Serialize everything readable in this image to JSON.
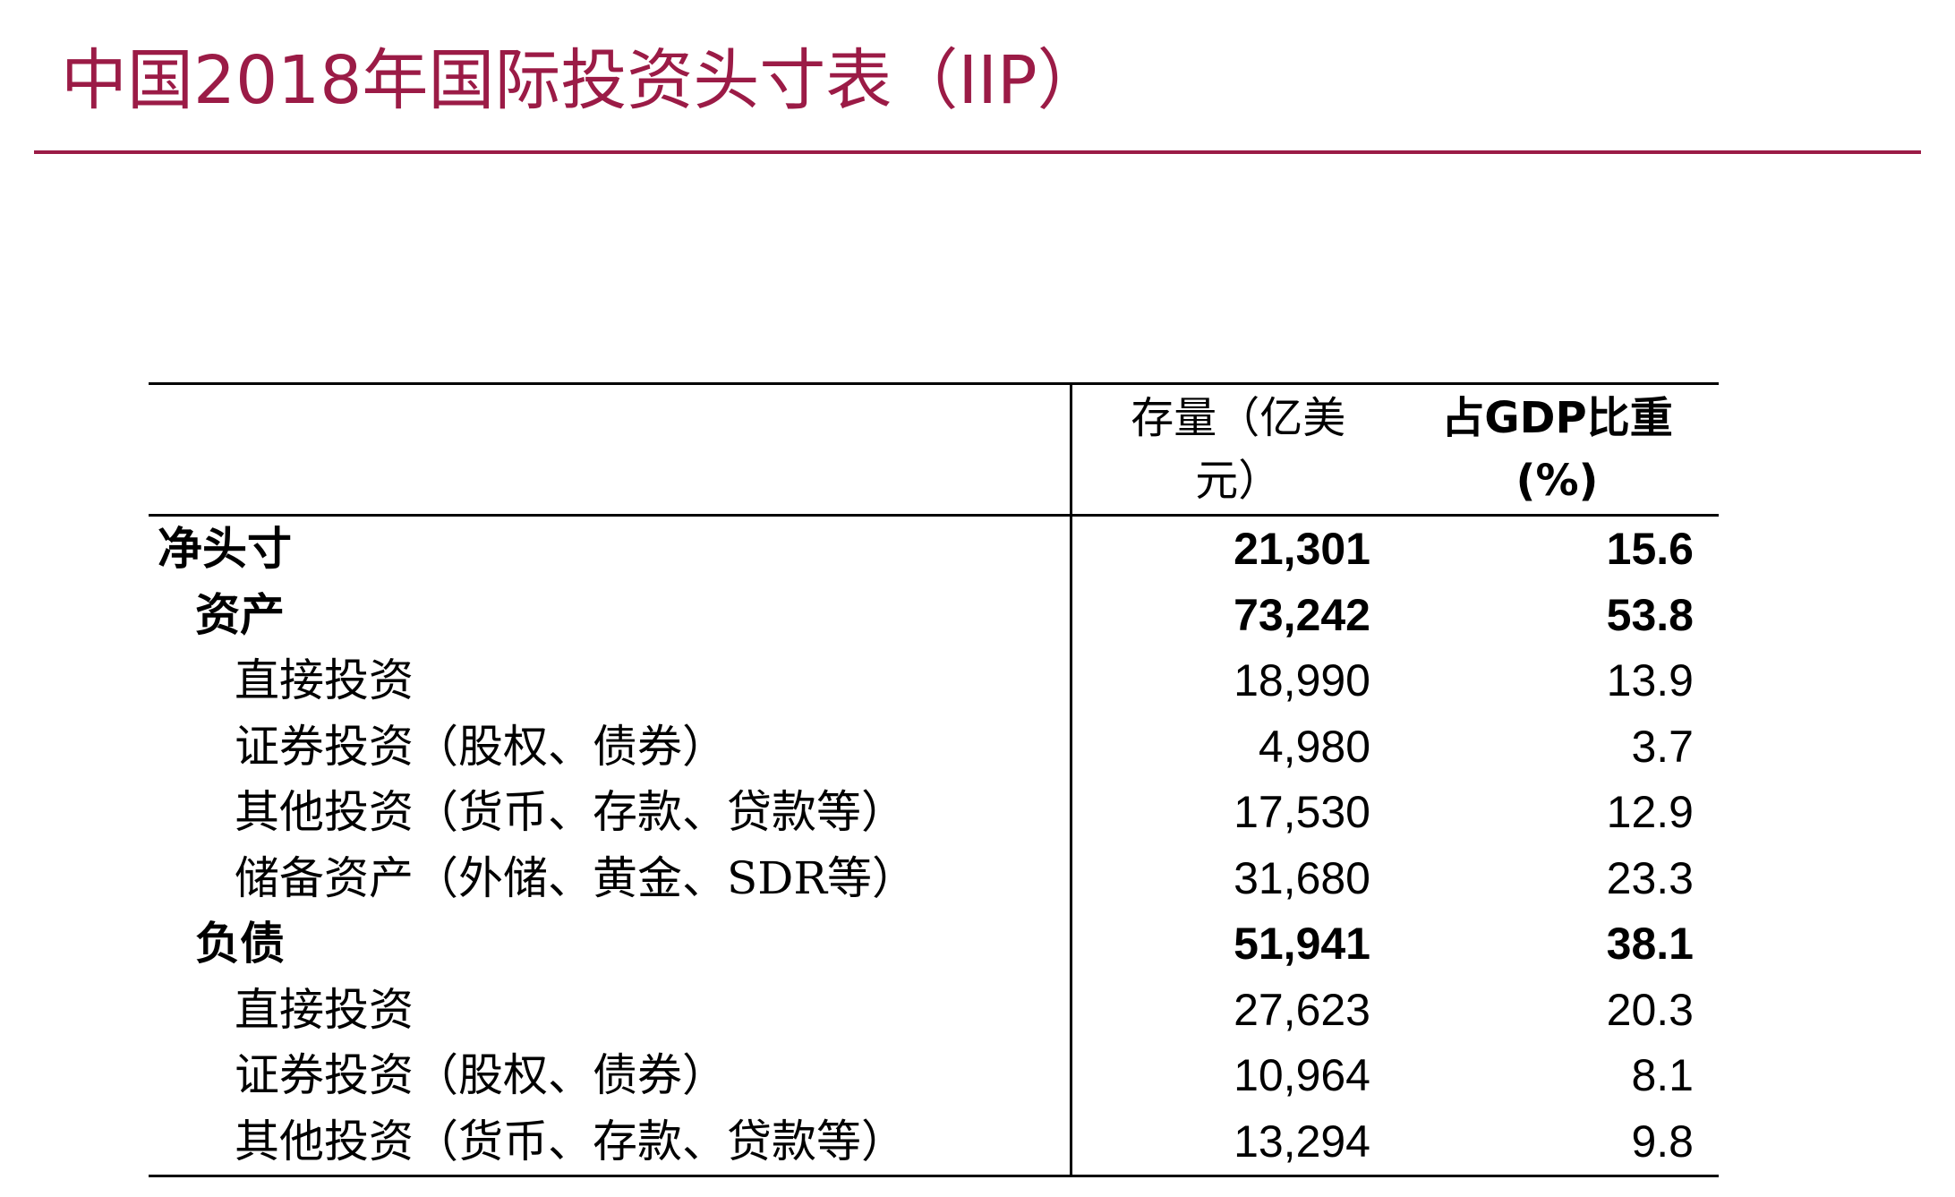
{
  "title": "中国2018年国际投资头寸表（IIP）",
  "colors": {
    "accent": "#9b1b46",
    "text": "#000000"
  },
  "table": {
    "headers": {
      "label": "",
      "stock_line1": "存量（亿美",
      "stock_line2": "元）",
      "gdp_line1": "占GDP比重",
      "gdp_line2": "(%)"
    },
    "rows": [
      {
        "label": "净头寸",
        "stock": "21,301",
        "gdp": "15.6"
      },
      {
        "label": "资产",
        "stock": "73,242",
        "gdp": "53.8"
      },
      {
        "label": "直接投资",
        "stock": "18,990",
        "gdp": "13.9"
      },
      {
        "label": "证券投资（股权、债券）",
        "stock": "4,980",
        "gdp": "3.7"
      },
      {
        "label": "其他投资（货币、存款、贷款等）",
        "stock": "17,530",
        "gdp": "12.9"
      },
      {
        "label": "储备资产（外储、黄金、SDR等）",
        "stock": "31,680",
        "gdp": "23.3"
      },
      {
        "label": "负债",
        "stock": "51,941",
        "gdp": "38.1"
      },
      {
        "label": "直接投资",
        "stock": "27,623",
        "gdp": "20.3"
      },
      {
        "label": "证券投资（股权、债券）",
        "stock": "10,964",
        "gdp": "8.1"
      },
      {
        "label": "其他投资（货币、存款、贷款等）",
        "stock": "13,294",
        "gdp": "9.8"
      }
    ]
  }
}
